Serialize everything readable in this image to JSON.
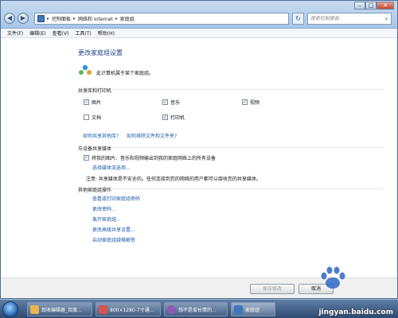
{
  "window": {
    "address": {
      "crumbs": [
        "控制面板",
        "网络和 Internet",
        "家庭组"
      ]
    },
    "search_placeholder": "搜索控制面板",
    "caption": {
      "minimize": "–",
      "maximize": "□",
      "close": "✕"
    }
  },
  "menu": [
    "文件(F)",
    "编辑(E)",
    "查看(V)",
    "工具(T)",
    "帮助(H)"
  ],
  "page": {
    "title": "更改家庭组设置",
    "belong_text": "此计算机属于某个家庭组。",
    "share_section": "共享库和打印机",
    "libraries": [
      {
        "label": "图片",
        "checked": true
      },
      {
        "label": "音乐",
        "checked": true
      },
      {
        "label": "视频",
        "checked": true
      },
      {
        "label": "文档",
        "checked": false
      },
      {
        "label": "打印机",
        "checked": true
      }
    ],
    "links_share": [
      "如何共享其他库?",
      "如何排除文件和文件夹?"
    ],
    "media_section": "与设备共享媒体",
    "media_checkbox": "将我的图片、音乐和视频输出到我的家庭网络上的所有设备",
    "media_checked": true,
    "media_link": "选择媒体流选项...",
    "media_note": "注意: 共享媒体是不安全的。任何连接到您的网络的用户都可以接收您的共享媒体。",
    "other_section": "其他家庭组操作",
    "other_links": [
      "查看或打印家庭组密码",
      "更改密码...",
      "离开家庭组...",
      "更改高级共享设置...",
      "启动家庭组疑难解答"
    ]
  },
  "footer": {
    "save_label": "保存修改",
    "cancel_label": "取消"
  },
  "taskbar": {
    "items": [
      {
        "label": "现收编辑器_百度...",
        "color": "#e8b64a"
      },
      {
        "label": "800×1280-7寸通...",
        "color": "#d9534f"
      },
      {
        "label": "想不是爱长情的...",
        "color": "#8e5bb5"
      },
      {
        "label": "家庭组",
        "color": "#3c77c0"
      }
    ]
  },
  "watermark": "jingyan.baidu.com",
  "watermark_logo_text": "Baidu 经验"
}
